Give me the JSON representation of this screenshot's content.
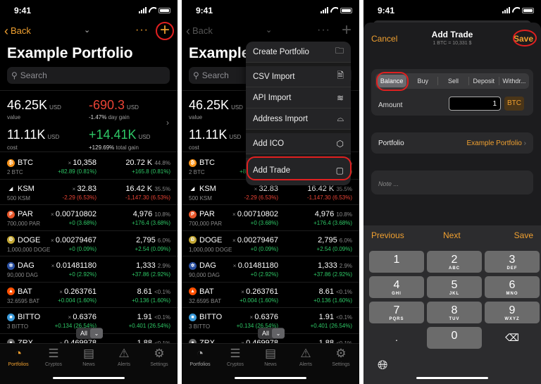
{
  "status": {
    "time": "9:41"
  },
  "portfolio": {
    "back_label": "Back",
    "title": "Example Portfolio",
    "search_placeholder": "Search",
    "summary": {
      "value": "46.25K",
      "value_unit": "USD",
      "value_label": "value",
      "day_gain": "-690.3",
      "day_gain_unit": "USD",
      "day_gain_pct": "-1.47%",
      "day_gain_label": "day gain",
      "cost": "11.11K",
      "cost_unit": "USD",
      "cost_label": "cost",
      "total_gain": "+14.41K",
      "total_gain_unit": "USD",
      "total_gain_pct": "+129.69%",
      "total_gain_label": "total gain"
    },
    "coins": [
      {
        "symbol": "BTC",
        "qty": "2 BTC",
        "price": "10,358",
        "price_change": "+82.89 (0.81%)",
        "value": "20.72",
        "value_unit": "K",
        "share": "44.8%",
        "value_change": "+165.8 (0.81%)",
        "trend": "up",
        "color": "#f7931a",
        "glyph": "₿"
      },
      {
        "symbol": "KSM",
        "qty": "500 KSM",
        "price": "32.83",
        "price_change": "-2.29 (6.53%)",
        "value": "16.42",
        "value_unit": "K",
        "share": "35.5%",
        "value_change": "-1,147.30 (6.53%)",
        "trend": "down",
        "color": "#000000",
        "glyph": "◢"
      },
      {
        "symbol": "PAR",
        "qty": "700,000 PAR",
        "price": "0.00710802",
        "price_change": "+0 (3.68%)",
        "value": "4,976",
        "value_unit": "",
        "share": "10.8%",
        "value_change": "+176.4 (3.68%)",
        "trend": "up",
        "color": "#e8562a",
        "glyph": "P"
      },
      {
        "symbol": "DOGE",
        "qty": "1,000,000 DOGE",
        "price": "0.00279467",
        "price_change": "+0 (0.09%)",
        "value": "2,795",
        "value_unit": "",
        "share": "6.0%",
        "value_change": "+2.54 (0.09%)",
        "trend": "up",
        "color": "#c2a633",
        "glyph": "Ð"
      },
      {
        "symbol": "DAG",
        "qty": "90,000 DAG",
        "price": "0.01481180",
        "price_change": "+0 (2.92%)",
        "value": "1,333",
        "value_unit": "",
        "share": "2.9%",
        "value_change": "+37.86 (2.92%)",
        "trend": "up",
        "color": "#2a4fa0",
        "glyph": "✲"
      },
      {
        "symbol": "BAT",
        "qty": "32.6595 BAT",
        "price": "0.263761",
        "price_change": "+0.004 (1.60%)",
        "value": "8.61",
        "value_unit": "",
        "share": "<0.1%",
        "value_change": "+0.136 (1.60%)",
        "trend": "up",
        "color": "#ff5000",
        "glyph": "▲"
      },
      {
        "symbol": "BITTO",
        "qty": "3 BITTO",
        "price": "0.6376",
        "price_change": "+0.134 (26.54%)",
        "value": "1.91",
        "value_unit": "",
        "share": "<0.1%",
        "value_change": "+0.401 (26.54%)",
        "trend": "up",
        "color": "#3a9ad9",
        "glyph": "■"
      },
      {
        "symbol": "ZRX",
        "qty": "",
        "price": "0.469978",
        "price_change": "",
        "value": "1.88",
        "value_unit": "",
        "share": "<0.1%",
        "value_change": "",
        "trend": "up",
        "color": "#666666",
        "glyph": "●"
      }
    ],
    "filter": {
      "label": "All"
    }
  },
  "tabs": [
    {
      "label": "Portfolios",
      "icon": "pie-chart-icon",
      "active": true
    },
    {
      "label": "Cryptos",
      "icon": "coins-stack-icon",
      "active": false
    },
    {
      "label": "News",
      "icon": "newspaper-icon",
      "active": false
    },
    {
      "label": "Alerts",
      "icon": "warning-icon",
      "active": false
    },
    {
      "label": "Settings",
      "icon": "gear-icon",
      "active": false
    }
  ],
  "add_menu": {
    "items": [
      {
        "label": "Create Portfolio",
        "icon": "folder-badge-icon"
      },
      {
        "label": "CSV Import",
        "icon": "document-icon"
      },
      {
        "label": "API Import",
        "icon": "layers-icon"
      },
      {
        "label": "Address Import",
        "icon": "tray-icon"
      },
      {
        "label": "Add ICO",
        "icon": "hexagon-icon"
      },
      {
        "label": "Add Trade",
        "icon": "clipboard-icon"
      }
    ]
  },
  "add_trade": {
    "cancel_label": "Cancel",
    "title": "Add Trade",
    "subtitle": "1 BTC = 10,331 $",
    "save_label": "Save",
    "types": [
      "Balance",
      "Buy",
      "Sell",
      "Deposit",
      "Withdr..."
    ],
    "selected_type": "Balance",
    "amount_label": "Amount",
    "amount_value": "1",
    "amount_unit": "BTC",
    "portfolio_label": "Portfolio",
    "portfolio_value": "Example Portfolio",
    "note_placeholder": "Note ...",
    "accessory": {
      "previous": "Previous",
      "next": "Next",
      "save": "Save"
    },
    "keypad": [
      {
        "n": "1",
        "s": ""
      },
      {
        "n": "2",
        "s": "ABC"
      },
      {
        "n": "3",
        "s": "DEF"
      },
      {
        "n": "4",
        "s": "GHI"
      },
      {
        "n": "5",
        "s": "JKL"
      },
      {
        "n": "6",
        "s": "MNO"
      },
      {
        "n": "7",
        "s": "PQRS"
      },
      {
        "n": "8",
        "s": "TUV"
      },
      {
        "n": "9",
        "s": "WXYZ"
      },
      {
        "n": ".",
        "s": ""
      },
      {
        "n": "0",
        "s": ""
      },
      {
        "n": "⌫",
        "s": ""
      }
    ]
  },
  "colors": {
    "accent": "#f0a030",
    "gain": "#2ec866",
    "loss": "#ea4335",
    "highlight": "#e02020"
  }
}
